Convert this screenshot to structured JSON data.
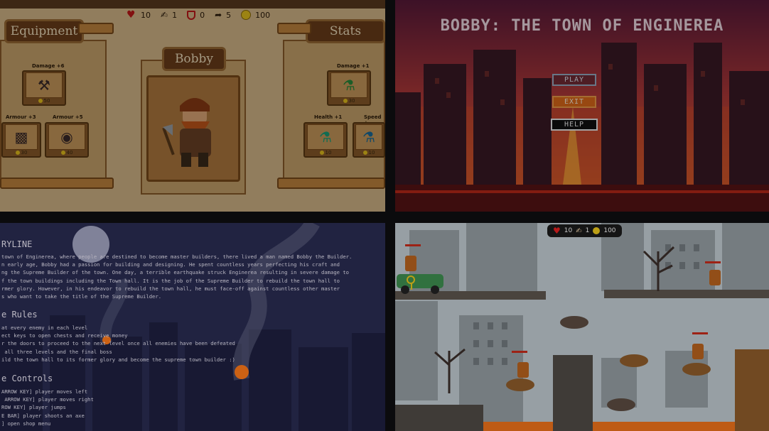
{
  "shop": {
    "hud": [
      {
        "icon": "heart-icon",
        "value": "10"
      },
      {
        "icon": "strength-arm-icon",
        "value": "1"
      },
      {
        "icon": "armour-shield-icon",
        "value": "0"
      },
      {
        "icon": "speed-runner-icon",
        "value": "5"
      },
      {
        "icon": "gold-coin-icon",
        "value": "100"
      }
    ],
    "equipment_title": "Equipment",
    "stats_title": "Stats",
    "character_name": "Bobby",
    "equipment_items": [
      {
        "label": "Damage +6",
        "icon": "battle-axe-icon",
        "price": "50"
      },
      {
        "label": "Armour +3",
        "icon": "wooden-shield-icon",
        "price": "30"
      },
      {
        "label": "Armour +5",
        "icon": "round-shield-icon",
        "price": "40"
      }
    ],
    "stats_items": [
      {
        "label": "Damage +1",
        "icon": "strength-potion-icon",
        "price": "30"
      },
      {
        "label": "Health +1",
        "icon": "health-potion-icon",
        "price": "10"
      },
      {
        "label": "Speed +",
        "icon": "speed-potion-icon",
        "price": "10"
      }
    ],
    "colors": {
      "parchment": "#d6b98a",
      "wood": "#6b3d1a",
      "gold": "#e6c21c"
    }
  },
  "menu": {
    "title": "BOBBY: THE TOWN OF ENGINEREA",
    "buttons": [
      {
        "label": "PLAY",
        "style": "outline-blue"
      },
      {
        "label": "EXIT",
        "style": "orange"
      },
      {
        "label": "HELP",
        "style": "outline-white"
      }
    ],
    "colors": {
      "sky_top": "#6a1f3a",
      "sky_bottom": "#e55a2a",
      "title": "#f3dfe8"
    }
  },
  "story": {
    "storyline_heading": "RYLINE",
    "storyline_lines": [
      "town of Enginerea, where people are destined to become master builders, there lived a man named Bobby the Builder.",
      "n early age, Bobby had a passion for building and designing. He spent countless years perfecting his craft and",
      "ng the Supreme Builder of the town. One day, a terrible earthquake struck Enginerea resulting in severe damage to",
      "f the town buildings including the Town hall. It is the job of the Supreme Builder to rebuild the town hall to",
      "rmer glory. However, in his endeavor to rebuild the town hall, he must face-off against countless other master",
      "s who want to take the title of the Supreme Builder."
    ],
    "rules_heading": "e Rules",
    "rules_lines": [
      "at every enemy in each level",
      "ect keys to open chests and receive money",
      "r the doors to proceed to the next level once all enemies have been defeated",
      " all three levels and the final boss",
      "ild the town hall to its former glory and become the supreme town builder :)"
    ],
    "controls_heading": "e Controls",
    "controls_lines": [
      "ARROW KEY] player moves left",
      " ARROW KEY] player moves right",
      "ROW KEY] player jumps",
      "E BAR] player shoots an axe",
      "] open shop menu"
    ]
  },
  "level": {
    "hud": [
      {
        "icon": "heart-icon",
        "value": "10"
      },
      {
        "icon": "strength-arm-icon",
        "value": "1"
      },
      {
        "icon": "gold-coin-icon",
        "value": "100"
      }
    ]
  }
}
